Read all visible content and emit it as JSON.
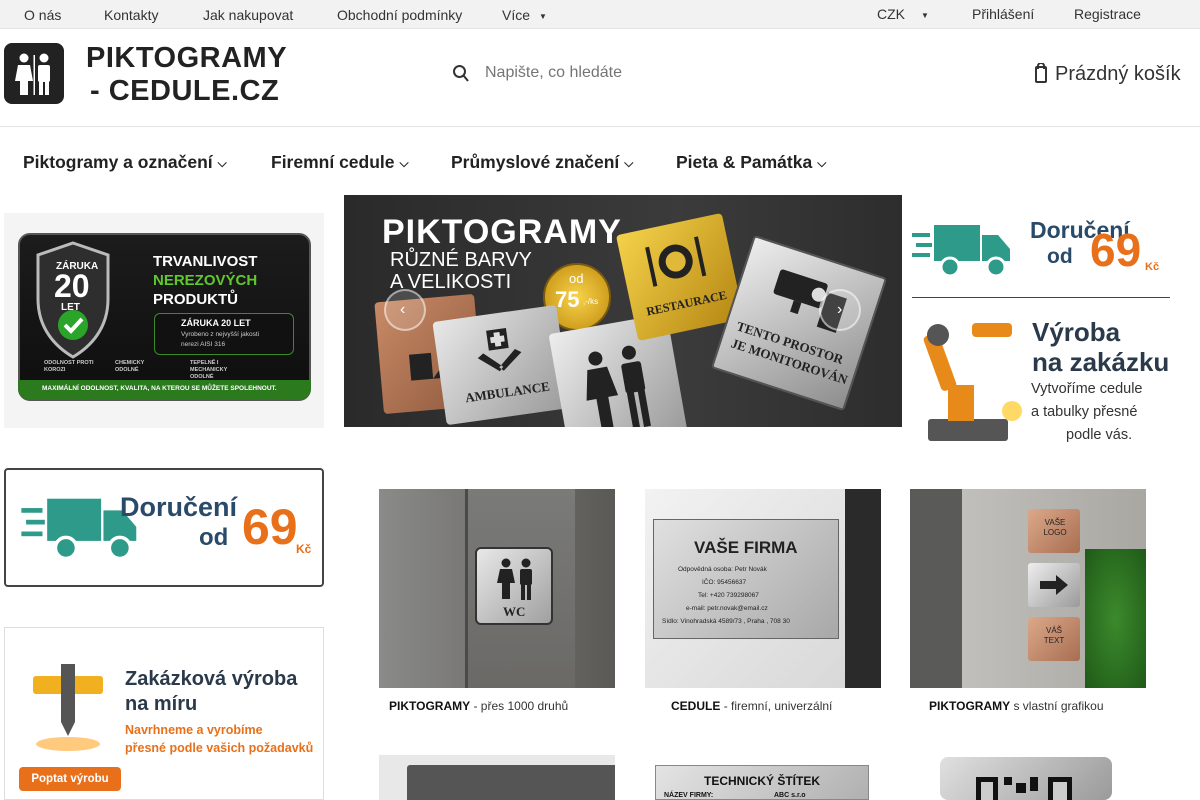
{
  "topbar": {
    "links": [
      "O nás",
      "Kontakty",
      "Jak nakupovat",
      "Obchodní podmínky",
      "Více"
    ],
    "currency": "CZK",
    "login": "Přihlášení",
    "register": "Registrace"
  },
  "logo": {
    "line1": "PIKTOGRAMY",
    "line2": "- CEDULE.CZ"
  },
  "search": {
    "placeholder": "Napište, co hledáte"
  },
  "cart": {
    "label": "Prázdný košík"
  },
  "nav": [
    "Piktogramy a označení",
    "Firemní cedule",
    "Průmyslové značení",
    "Pieta & Památka"
  ],
  "promo_durability": {
    "badge_top": "ZÁRUKA",
    "badge_num": "20",
    "badge_bot": "LET",
    "line1": "TRVANLIVOST",
    "line2": "NEREZOVÝCH",
    "line3": "PRODUKTŮ",
    "w_title": "ZÁRUKA 20 LET",
    "w_text1": "Vyrobeno z nejvyšší jakosti",
    "w_text2": "nerezi AISI 316",
    "f1": "ODOLNOST PROTI KOROZI",
    "f2": "CHEMICKY ODOLNÉ",
    "f3": "TEPELNĚ I MECHANICKY ODOLNÉ",
    "footer": "MAXIMÁLNÍ ODOLNOST, KVALITA, NA KTEROU SE MŮŽETE SPOLEHNOUT."
  },
  "hero": {
    "title": "PIKTOGRAMY",
    "subtitle1": "RŮZNÉ BARVY",
    "subtitle2": "A VELIKOSTI",
    "price_from": "od",
    "price": "75",
    "price_unit": ",-/ks",
    "sign_ambulance": "AMBULANCE",
    "sign_restaurant": "RESTAURACE",
    "sign_camera1": "TENTO PROSTOR",
    "sign_camera2": "JE MONITOROVÁN"
  },
  "delivery": {
    "label1": "Doručení",
    "label2": "od",
    "price": "69",
    "currency": "Kč"
  },
  "custom": {
    "title1": "Výroba",
    "title2": "na zakázku",
    "text1": "Vytvoříme cedule",
    "text2": "a tabulky přesné",
    "text3": "podle vás."
  },
  "custom2": {
    "title1": "Zakázková výroba",
    "title2": "na míru",
    "text1": "Navrhneme a vyrobíme",
    "text2": "přesné podle vašich požadavků",
    "button": "Poptat výrobu"
  },
  "categories": [
    {
      "bold": "PIKTOGRAMY",
      "rest": "- přes 1000 druhů",
      "sign": "WC"
    },
    {
      "bold": "CEDULE",
      "rest": "- firemní, univerzální",
      "sign_title": "VAŠE FIRMA",
      "sign_lines": [
        "Odpovědná osoba: Petr Novák",
        "IČO: 95456637",
        "Tel: +420 739298067",
        "e-mail: petr.novak@email.cz",
        "Sídlo: Vinohradská 4589/73 , Praha , 708 30"
      ]
    },
    {
      "bold": "PIKTOGRAMY",
      "rest": "s vlastní grafikou",
      "sign_top": "VAŠE LOGO",
      "sign_bot": "VÁŠ TEXT"
    }
  ],
  "tech": {
    "title": "TECHNICKÝ ŠTÍTEK",
    "row_label": "NÁZEV FIRMY:",
    "row_value": "ABC s.r.o"
  }
}
